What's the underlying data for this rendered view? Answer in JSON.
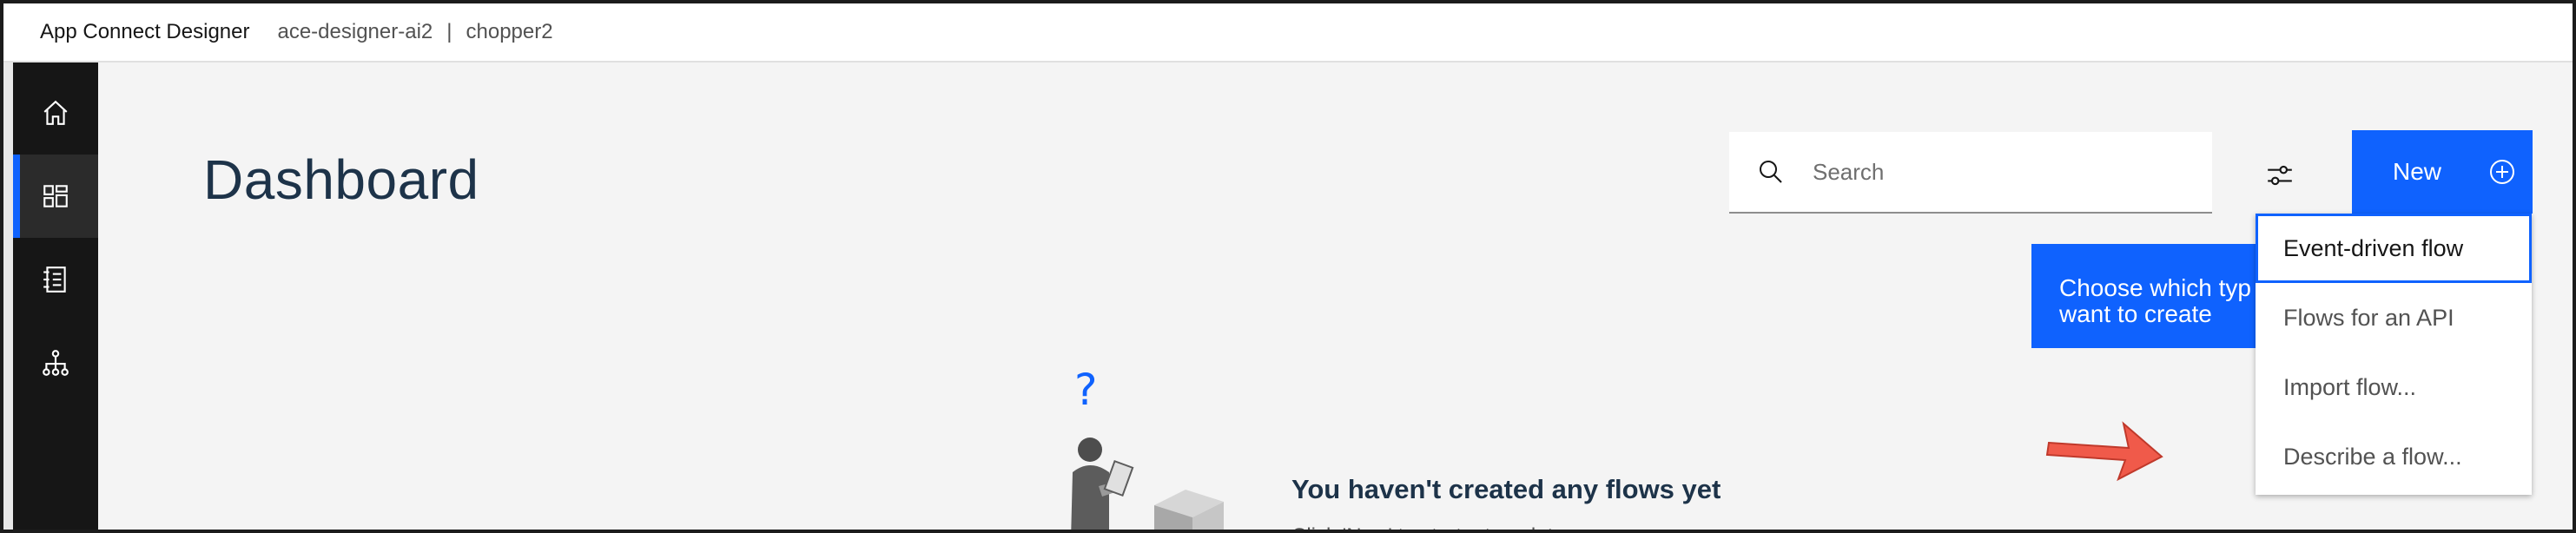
{
  "header": {
    "app_name": "App Connect Designer",
    "instance": "ace-designer-ai2",
    "separator": "|",
    "workspace": "chopper2"
  },
  "nav": {
    "items": [
      {
        "icon": "home-icon",
        "active": false
      },
      {
        "icon": "dashboard-icon",
        "active": true
      },
      {
        "icon": "catalog-icon",
        "active": false
      },
      {
        "icon": "hierarchy-icon",
        "active": false
      }
    ]
  },
  "main": {
    "title": "Dashboard",
    "search_placeholder": "Search",
    "new_label": "New",
    "tooltip_line1": "Choose which typ",
    "tooltip_line2": "want to create",
    "menu": [
      "Event-driven flow",
      "Flows for an API",
      "Import flow...",
      "Describe a flow..."
    ],
    "empty_title": "You haven't created any flows yet",
    "empty_sub": "Click 'New' to start a template",
    "question_mark": "?"
  },
  "colors": {
    "accent": "#0f62fe",
    "nav_bg": "#161616",
    "main_bg": "#f4f4f4",
    "arrow": "#f05a4a",
    "title": "#1d3349"
  }
}
